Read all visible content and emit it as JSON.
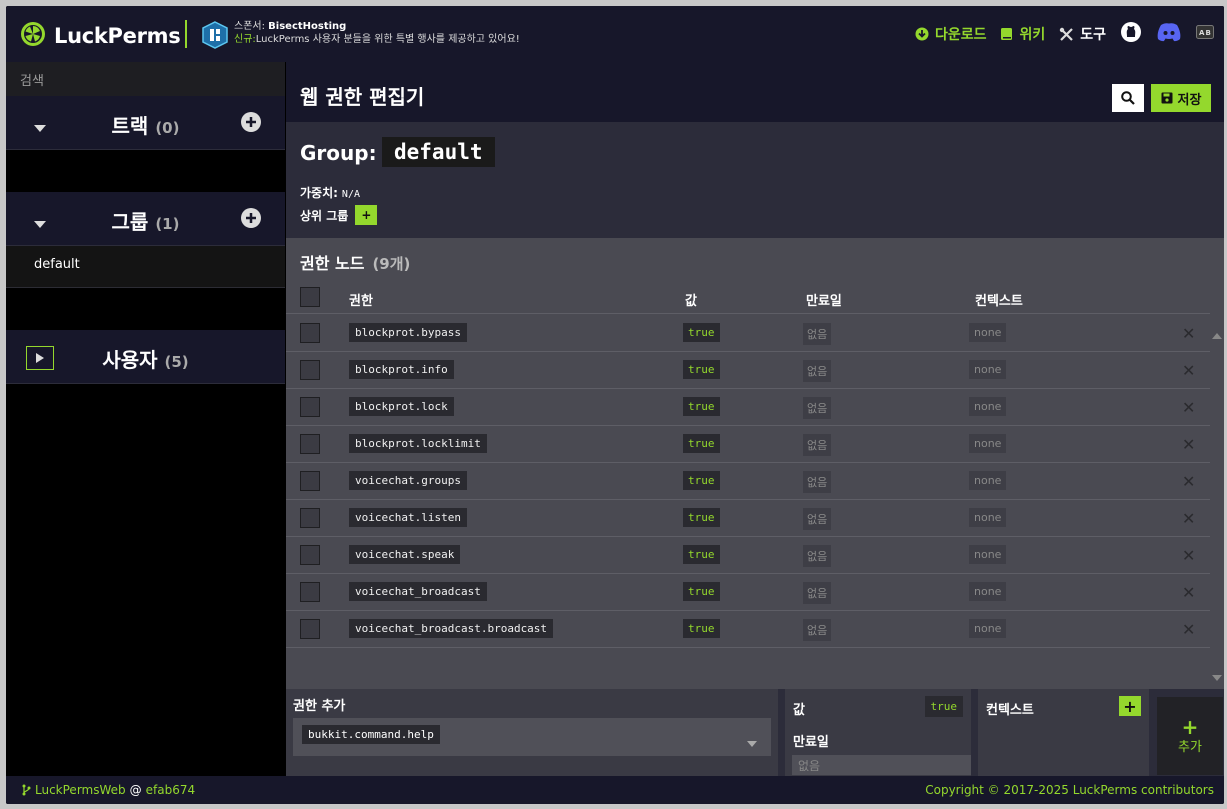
{
  "header": {
    "app_name": "LuckPerms",
    "sponsor_line": "스폰서: ",
    "sponsor_name": "BisectHosting",
    "sponsor_new": "신규:",
    "sponsor_msg": "LuckPerms 사용자 분들을 위한 특별 행사를 제공하고 있어요!",
    "nav": {
      "download": "다운로드",
      "wiki": "위키",
      "tools": "도구"
    }
  },
  "sidebar": {
    "search_placeholder": "검색",
    "tracks": {
      "label": "트랙",
      "count": "(0)"
    },
    "groups": {
      "label": "그룹",
      "count": "(1)",
      "items": [
        "default"
      ]
    },
    "users": {
      "label": "사용자",
      "count": "(5)"
    }
  },
  "editor": {
    "title": "웹 권한 편집기",
    "save_label": "저장",
    "group_label": "Group:",
    "group_name": "default",
    "weight_label": "가중치:",
    "weight_value": "N/A",
    "parent_label": "상위 그룹",
    "nodes_title": "권한 노드",
    "nodes_count": "(9개)",
    "columns": {
      "permission": "권한",
      "value": "값",
      "expiry": "만료일",
      "context": "컨텍스트"
    },
    "rows": [
      {
        "perm": "blockprot.bypass",
        "value": "true",
        "expiry": "없음",
        "context": "none"
      },
      {
        "perm": "blockprot.info",
        "value": "true",
        "expiry": "없음",
        "context": "none"
      },
      {
        "perm": "blockprot.lock",
        "value": "true",
        "expiry": "없음",
        "context": "none"
      },
      {
        "perm": "blockprot.locklimit",
        "value": "true",
        "expiry": "없음",
        "context": "none"
      },
      {
        "perm": "voicechat.groups",
        "value": "true",
        "expiry": "없음",
        "context": "none"
      },
      {
        "perm": "voicechat.listen",
        "value": "true",
        "expiry": "없음",
        "context": "none"
      },
      {
        "perm": "voicechat.speak",
        "value": "true",
        "expiry": "없음",
        "context": "none"
      },
      {
        "perm": "voicechat_broadcast",
        "value": "true",
        "expiry": "없음",
        "context": "none"
      },
      {
        "perm": "voicechat_broadcast.broadcast",
        "value": "true",
        "expiry": "없음",
        "context": "none"
      }
    ],
    "add": {
      "perm_label": "권한 추가",
      "perm_value": "bukkit.command.help",
      "value_label": "값",
      "value_value": "true",
      "expiry_label": "만료일",
      "expiry_placeholder": "없음",
      "context_label": "컨텍스트",
      "add_label": "추가"
    }
  },
  "footer": {
    "project": "LuckPermsWeb",
    "at": "@",
    "commit": "efab674",
    "copyright": "Copyright © 2017-2025 LuckPerms contributors"
  },
  "colors": {
    "accent": "#94d82d",
    "header": "#17172a",
    "panel": "#4a4a52"
  }
}
